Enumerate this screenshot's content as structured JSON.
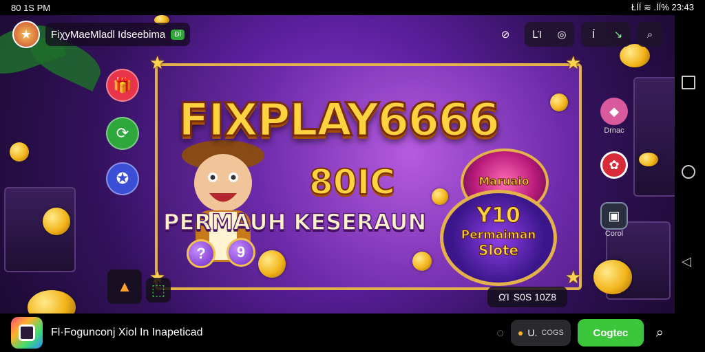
{
  "status": {
    "time_left": "80 1S PM",
    "right_text": "ŁÍÍ ≋ .ÍÍ% 23:43"
  },
  "header": {
    "title": "FiχyMaeMladl Idseebima",
    "badge": "ÐÍ",
    "icons": [
      {
        "name": "target-icon",
        "label": "⊘"
      },
      {
        "name": "stats-icon",
        "label": "ԼΊ"
      },
      {
        "name": "chat-icon",
        "label": "◎"
      },
      {
        "name": "info-icon",
        "label": "Í"
      },
      {
        "name": "share-icon",
        "label": "↘"
      },
      {
        "name": "search-icon",
        "label": "⌕"
      }
    ]
  },
  "banner": {
    "title": "FIXPLAY6666",
    "subnumber": "80IC",
    "tagline": "PERMAUH KESERAUN",
    "med_top_text": "Maruaio",
    "med_bottom_line1": "Y10",
    "med_bottom_line2": "Permaiman",
    "med_bottom_line3": "Slote",
    "ball1": "?",
    "ball2": "9"
  },
  "right_menu": {
    "item1_label": "Drnac",
    "item3_label": "Corol"
  },
  "counter": {
    "icon": "ΩΊ",
    "value": "S0S 10Z8"
  },
  "bottom": {
    "title": "Fl·Fogunconj Xiol In Inapeticad",
    "user_prefix": "U.",
    "user_sub": "COGS",
    "cta": "Cogtec"
  },
  "colors": {
    "accent_green": "#3cc63c",
    "gold": "#ffd23f",
    "purple": "#5a1f9c"
  }
}
